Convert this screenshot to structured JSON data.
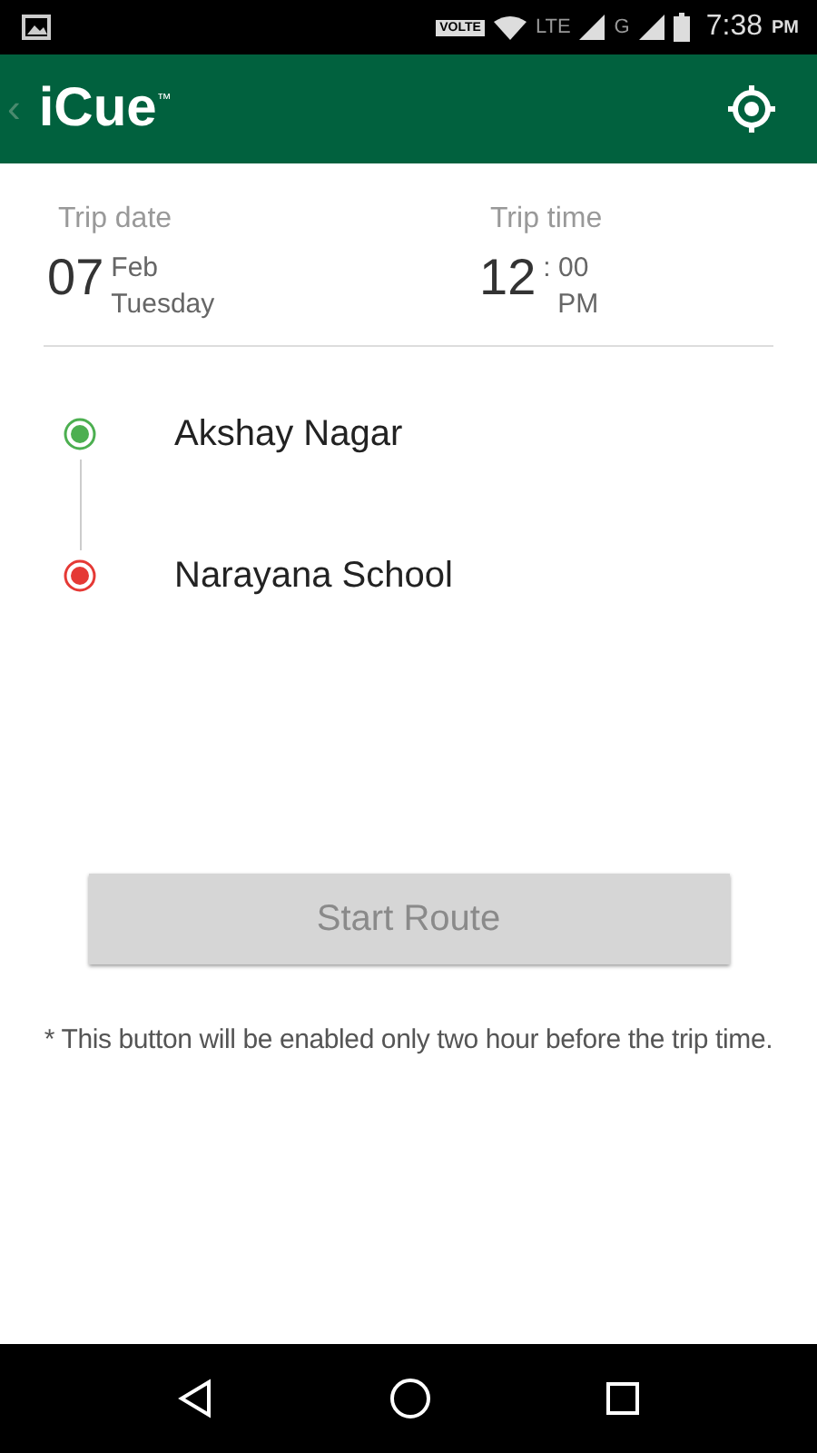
{
  "status_bar": {
    "volte": "VOLTE",
    "network_1": "LTE",
    "network_2": "G",
    "time": "7:38",
    "meridiem": "PM"
  },
  "app_bar": {
    "back": "‹",
    "logo": "iCue",
    "trademark": "™"
  },
  "trip": {
    "date_label": "Trip date",
    "day": "07",
    "month": "Feb",
    "weekday": "Tuesday",
    "time_label": "Trip time",
    "hour": "12",
    "separator": ":",
    "minute": "00",
    "meridiem": "PM"
  },
  "stops": [
    {
      "name": "Akshay Nagar",
      "color": "#4caf50"
    },
    {
      "name": "Narayana School",
      "color": "#e53935"
    }
  ],
  "start_button": {
    "label": "Start Route",
    "disabled": true
  },
  "note": "* This button will be enabled only two hour before the trip time."
}
